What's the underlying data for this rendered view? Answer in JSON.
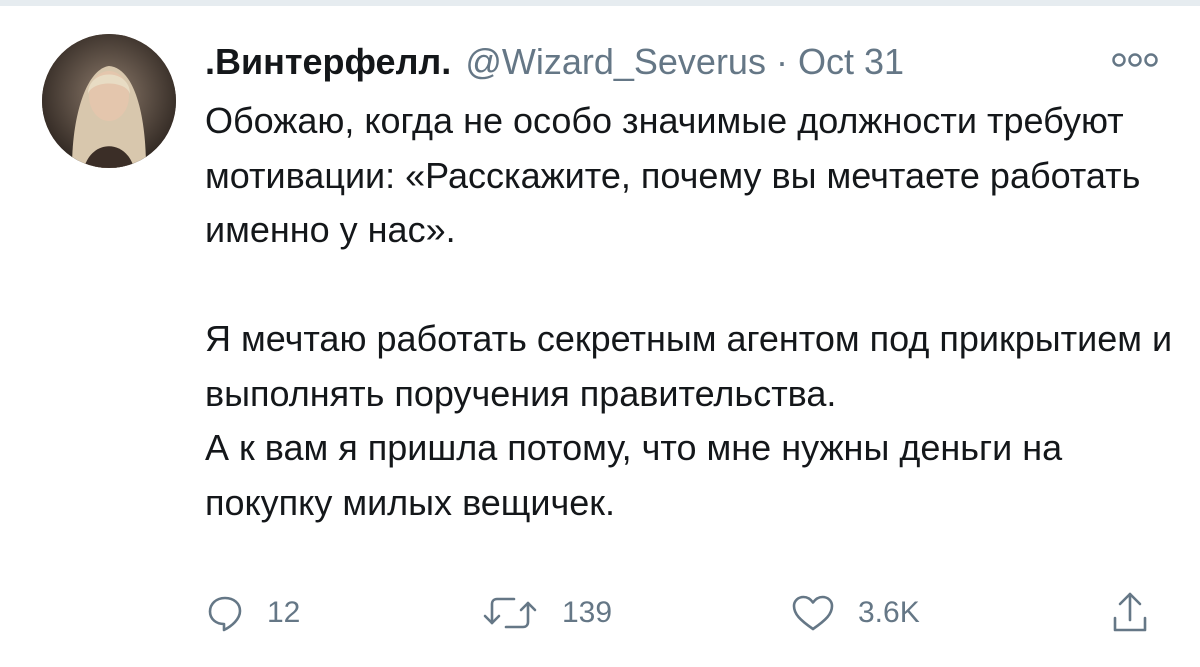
{
  "tweet": {
    "display_name": ".Винтерфелл.",
    "handle": "@Wizard_Severus",
    "separator": "·",
    "date": "Oct 31",
    "text_paragraphs": [
      "Обожаю, когда не особо значимые должности требуют мотивации: «Расскажите, почему вы мечтаете работать именно у нас».",
      "",
      "Я мечтаю работать секретным агентом под прикрытием и выполнять поручения правительства.",
      "А к вам я пришла потому, что мне нужны деньги на покупку милых вещичек."
    ]
  },
  "actions": {
    "reply_count": "12",
    "retweet_count": "139",
    "like_count": "3.6K"
  },
  "icons": {
    "avatar": "profile-photo",
    "more": "more-options-icon",
    "reply": "reply-icon",
    "retweet": "retweet-icon",
    "like": "heart-icon",
    "share": "share-icon"
  },
  "colors": {
    "text": "#14171a",
    "secondary": "#657786",
    "icon": "#657786",
    "divider": "#e6ecf0"
  }
}
